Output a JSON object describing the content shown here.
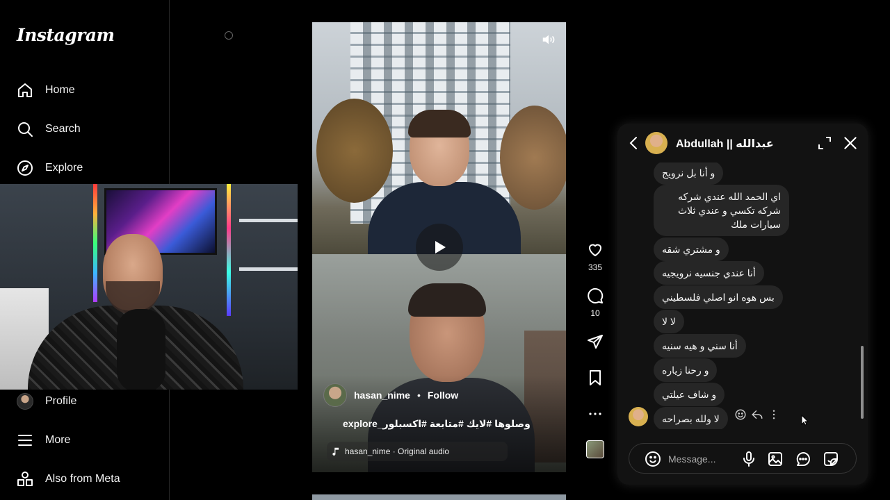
{
  "app": {
    "brand": "Instagram"
  },
  "sidebar": {
    "items": [
      {
        "label": "Home",
        "icon": "home-icon"
      },
      {
        "label": "Search",
        "icon": "search-icon"
      },
      {
        "label": "Explore",
        "icon": "compass-icon"
      },
      {
        "label": "Profile",
        "icon": "avatar"
      },
      {
        "label": "More",
        "icon": "menu-icon"
      },
      {
        "label": "Also from Meta",
        "icon": "grid-icon"
      }
    ]
  },
  "reel": {
    "author": "hasan_nime",
    "separator": "•",
    "follow_label": "Follow",
    "caption": "وصلوها #لايك #متابعة #اكسبلور_explore",
    "audio": "hasan_nime · Original audio"
  },
  "actions": {
    "likes": "335",
    "comments": "10"
  },
  "chat": {
    "contact_name": "Abdullah || عبدالله",
    "messages": [
      "و أنا بل نرويج",
      "اي الحمد الله عندي شركه شركه تكسي و عندي ثلاث سيارات ملك",
      "و مشتري شقه",
      "أنا عندي جنسيه نرويجيه",
      "بس هوه انو اصلي فلسطيني",
      "لا لا",
      "أنا سني و هيه سنيه",
      "و رحنا زياره",
      "و شاف عيلتي",
      "لا ولله بصراحه"
    ],
    "composer_placeholder": "Message..."
  },
  "colors": {
    "background": "#000000",
    "panel": "#121212",
    "bubble": "#262626",
    "text": "#f5f5f5"
  }
}
